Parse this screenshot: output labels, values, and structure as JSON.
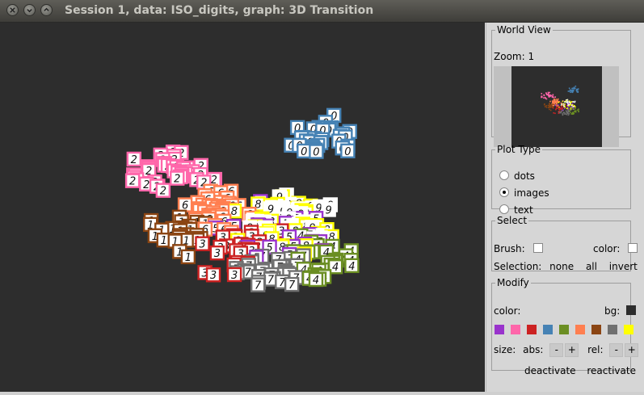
{
  "window": {
    "title": "Session 1, data: ISO_digits, graph: 3D Transition"
  },
  "world_view": {
    "legend": "World View",
    "zoom_label": "Zoom:",
    "zoom_value": "1"
  },
  "plot_type": {
    "legend": "Plot Type",
    "options": [
      "dots",
      "images",
      "text"
    ],
    "selected": "images"
  },
  "select": {
    "legend": "Select",
    "brush_label": "Brush:",
    "color_label": "color:",
    "selection_label": "Selection:",
    "none": "none",
    "all": "all",
    "invert": "invert"
  },
  "modify": {
    "legend": "Modify",
    "color_label": "color:",
    "bg_label": "bg:",
    "bg_color": "#2d2d2d",
    "swatches": [
      "#9933cc",
      "#ff66aa",
      "#cc2222",
      "#4682b4",
      "#6b8e23",
      "#ff7f50",
      "#8b4513",
      "#707070",
      "#ffff00"
    ],
    "size_label": "size:",
    "abs_label": "abs:",
    "rel_label": "rel:",
    "minus": "-",
    "plus": "+",
    "deactivate": "deactivate",
    "reactivate": "reactivate"
  },
  "scatter": {
    "digit_colors": {
      "0": "#4682b4",
      "1": "#8b4513",
      "2": "#ff66aa",
      "3": "#cc2222",
      "4": "#6b8e23",
      "5": "#9933cc",
      "6": "#ff7f50",
      "7": "#707070",
      "8": "#ffff00",
      "9": "#ffffff"
    }
  }
}
